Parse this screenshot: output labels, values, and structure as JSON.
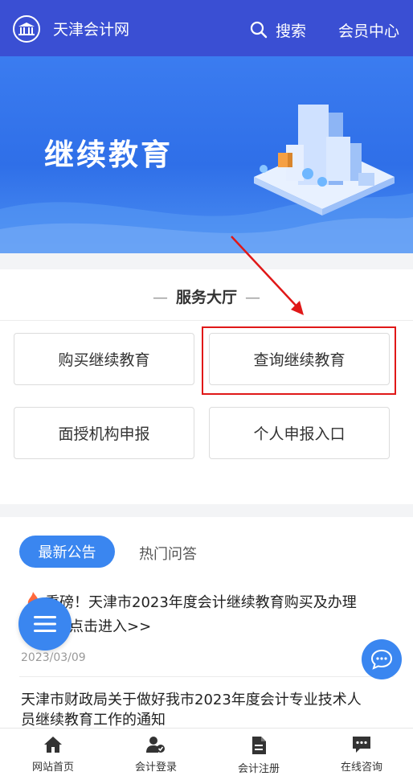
{
  "header": {
    "site_title": "天津会计网",
    "search_label": "搜索",
    "member_label": "会员中心"
  },
  "banner": {
    "title": "继续教育"
  },
  "service": {
    "title": "服务大厅",
    "buttons": [
      {
        "label": "购买继续教育"
      },
      {
        "label": "查询继续教育"
      },
      {
        "label": "面授机构申报"
      },
      {
        "label": "个人申报入口"
      }
    ]
  },
  "tabs": [
    {
      "label": "最新公告",
      "active": true
    },
    {
      "label": "热门问答",
      "active": false
    }
  ],
  "news": [
    {
      "line1": "重磅！天津市2023年度会计继续教育购买及办理",
      "line2": "点击进入>>",
      "date": "2023/03/09"
    },
    {
      "line1": "天津市财政局关于做好我市2023年度会计专业技术人",
      "line2": "员继续教育工作的通知"
    }
  ],
  "bottom_nav": [
    {
      "label": "网站首页",
      "icon": "home-icon"
    },
    {
      "label": "会计登录",
      "icon": "user-login-icon"
    },
    {
      "label": "会计注册",
      "icon": "document-icon"
    },
    {
      "label": "在线咨询",
      "icon": "chat-icon"
    }
  ],
  "colors": {
    "header_bg": "#3a4fd3",
    "accent": "#3a86f0",
    "highlight": "#e01818"
  }
}
